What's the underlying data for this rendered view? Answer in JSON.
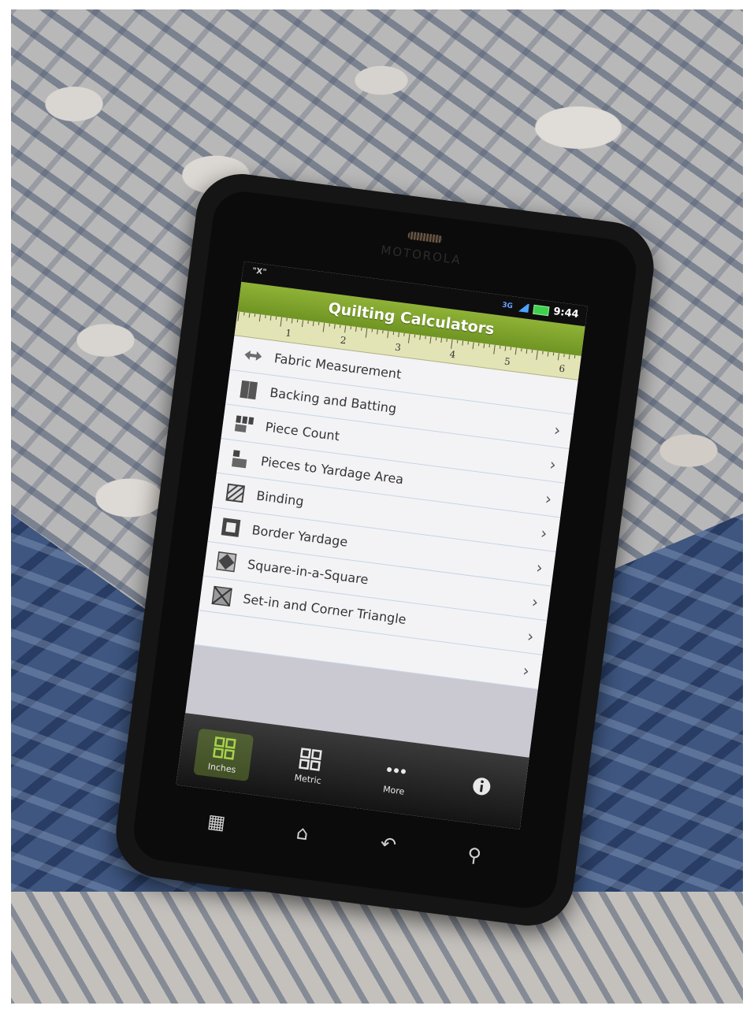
{
  "status_bar": {
    "notification": "\"X\"",
    "network": "3G",
    "time": "9:44"
  },
  "brand": "MOTOROLA",
  "app": {
    "title": "Quilting Calculators"
  },
  "ruler": {
    "numbers": [
      "1",
      "2",
      "3",
      "4",
      "5",
      "6"
    ]
  },
  "menu": {
    "items": [
      {
        "label": "Fabric Measurement",
        "icon": "arrows-icon"
      },
      {
        "label": "Backing and Batting",
        "icon": "backing-icon"
      },
      {
        "label": "Piece Count",
        "icon": "piece-count-icon"
      },
      {
        "label": "Pieces to Yardage Area",
        "icon": "pieces-yardage-icon"
      },
      {
        "label": "Binding",
        "icon": "binding-icon"
      },
      {
        "label": "Border Yardage",
        "icon": "border-icon"
      },
      {
        "label": "Square-in-a-Square",
        "icon": "square-in-square-icon"
      },
      {
        "label": "Set-in and Corner Triangle",
        "icon": "triangle-icon"
      }
    ],
    "chevron": "›"
  },
  "tabs": [
    {
      "label": "Inches",
      "icon": "grid-icon",
      "active": true
    },
    {
      "label": "Metric",
      "icon": "grid-icon",
      "active": false
    },
    {
      "label": "More",
      "icon": "dots-icon",
      "active": false
    },
    {
      "label": "",
      "icon": "info-icon",
      "active": false
    }
  ],
  "colors": {
    "title_bar": "#7ea22c",
    "ruler": "#e3e4b5",
    "list_bg": "#f3f3f5"
  }
}
